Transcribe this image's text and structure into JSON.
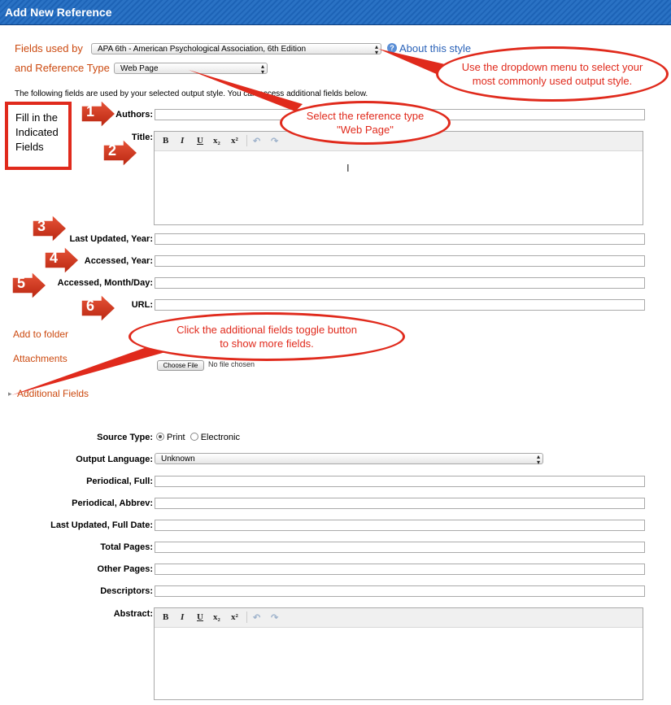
{
  "window": {
    "title": "Add New Reference"
  },
  "fields_used_by": {
    "label": "Fields used by",
    "value": "APA 6th - American Psychological Association, 6th Edition",
    "about_link": "About this style"
  },
  "reference_type": {
    "label": "and Reference Type",
    "value": "Web Page"
  },
  "info_text": "The following fields are used by your selected output style. You can access additional fields below.",
  "fill_box": {
    "lines": [
      "Fill in the",
      "Indicated",
      "Fields"
    ]
  },
  "fields": {
    "authors": "Authors:",
    "title": "Title:",
    "last_updated_year": "Last Updated, Year:",
    "accessed_year": "Accessed, Year:",
    "accessed_month_day": "Accessed, Month/Day:",
    "url": "URL:"
  },
  "toolbar": {
    "bold": "B",
    "italic": "I",
    "underline": "U",
    "subscript": "x₂",
    "superscript": "x²",
    "undo": "↶",
    "redo": "↷"
  },
  "markers": [
    "1",
    "2",
    "3",
    "4",
    "5",
    "6"
  ],
  "links": {
    "add_to_folder": "Add to folder",
    "attachments": "Attachments",
    "choose_file": "Choose File",
    "no_file": "No file chosen",
    "additional_fields": "Additional Fields"
  },
  "callouts": {
    "output_style": "Use the dropdown menu to select your most commonly used output style.",
    "ref_type": "Select the reference type \"Web Page\"",
    "additional": "Click the additional fields toggle button to show more fields."
  },
  "additional": {
    "source_type_label": "Source Type:",
    "source_print": "Print",
    "source_electronic": "Electronic",
    "output_language_label": "Output Language:",
    "output_language_value": "Unknown",
    "periodical_full": "Periodical, Full:",
    "periodical_abbrev": "Periodical, Abbrev:",
    "last_updated_full_date": "Last Updated, Full Date:",
    "total_pages": "Total Pages:",
    "other_pages": "Other Pages:",
    "descriptors": "Descriptors:",
    "abstract": "Abstract:"
  },
  "colors": {
    "callout_red": "#e02a1c",
    "label_orange": "#cc4a10",
    "titlebar_blue": "#1d63b6"
  }
}
